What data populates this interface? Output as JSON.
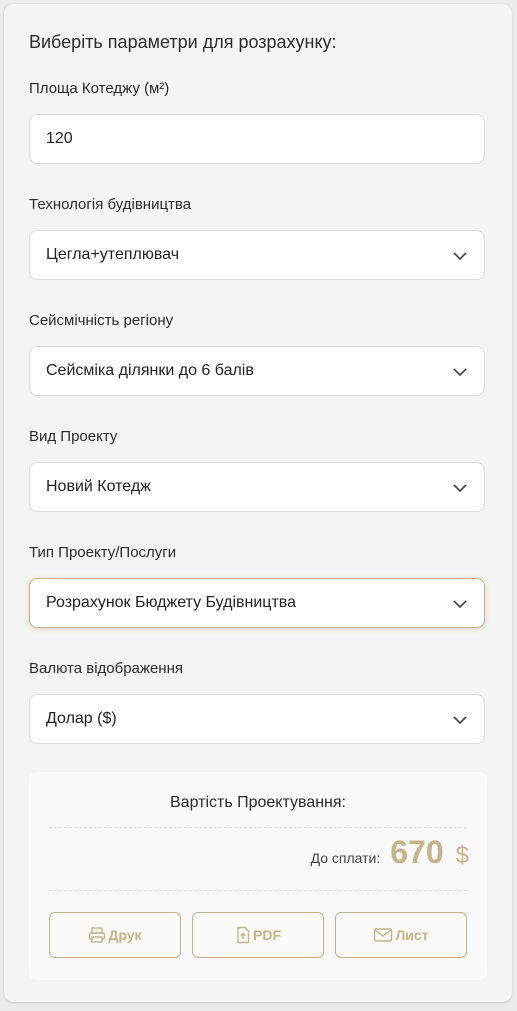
{
  "form": {
    "heading": "Виберіть параметри для розрахунку:",
    "area": {
      "label": "Площа Котеджу (м²)",
      "value": "120"
    },
    "technology": {
      "label": "Технологія будівництва",
      "value": "Цегла+утеплювач"
    },
    "seismic": {
      "label": "Сейсмічність регіону",
      "value": "Сейсміка ділянки до 6 балів"
    },
    "project_kind": {
      "label": "Вид Проекту",
      "value": "Новий Котедж"
    },
    "project_type": {
      "label": "Тип Проекту/Послуги",
      "value": "Розрахунок Бюджету Будівництва"
    },
    "currency": {
      "label": "Валюта відображення",
      "value": "Долар ($)"
    }
  },
  "result": {
    "title": "Вартість Проектування:",
    "pay_label": "До сплати:",
    "amount": "670",
    "currency_symbol": "$",
    "buttons": {
      "print": "Друк",
      "pdf": "PDF",
      "letter": "Лист"
    }
  },
  "colors": {
    "accent": "#c7b28c",
    "text": "#2b2b2b",
    "background": "#f4f4f4"
  },
  "icons": [
    "chevron-down-icon",
    "printer-icon",
    "file-pdf-icon",
    "envelope-icon"
  ]
}
